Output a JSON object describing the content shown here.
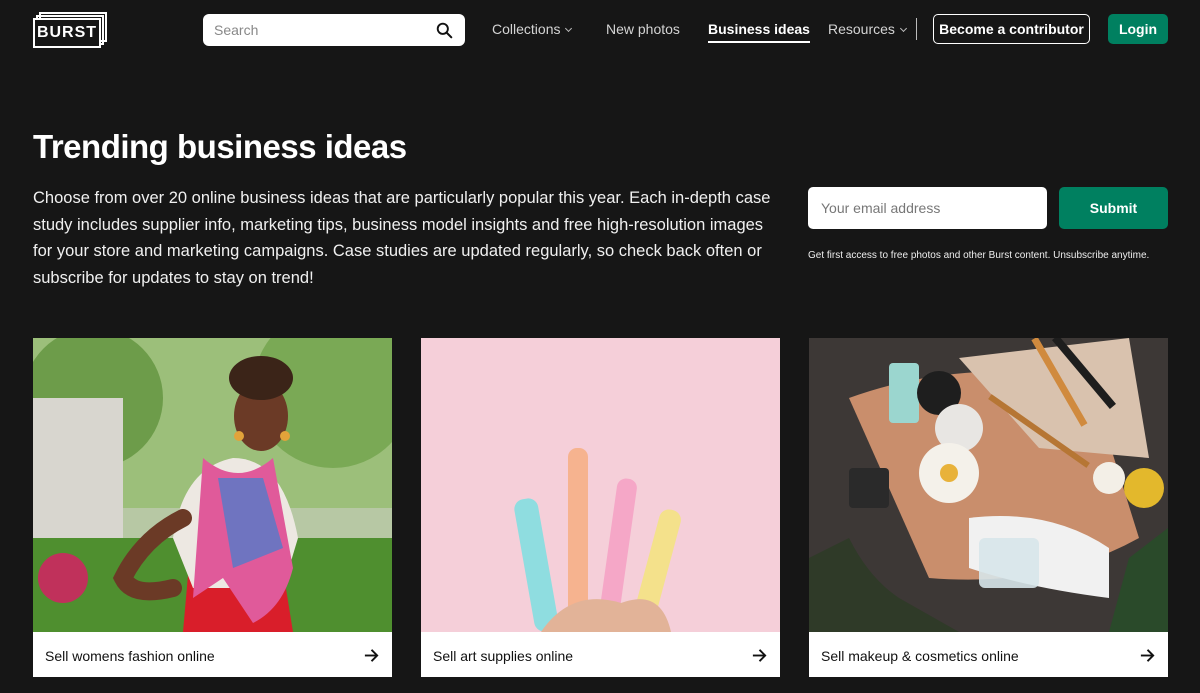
{
  "brand": {
    "logo_text": "BURST"
  },
  "search": {
    "placeholder": "Search",
    "icon": "search-icon"
  },
  "nav": {
    "collections": "Collections",
    "new_photos": "New photos",
    "business_ideas": "Business ideas",
    "resources": "Resources",
    "contributor_button": "Become a contributor",
    "login_button": "Login"
  },
  "hero": {
    "title": "Trending business ideas",
    "description": "Choose from over 20 online business ideas that are particularly popular this year. Each in-depth case study includes supplier info, marketing tips, business model insights and free high-resolution images for your store and marketing campaigns. Case studies are updated regularly, so check back often or subscribe for updates to stay on trend!"
  },
  "subscribe": {
    "email_placeholder": "Your email address",
    "submit_label": "Submit",
    "fineprint": "Get first access to free photos and other Burst content. Unsubscribe anytime."
  },
  "cards": [
    {
      "label": "Sell womens fashion online",
      "icon": "arrow-right-icon"
    },
    {
      "label": "Sell art supplies online",
      "icon": "arrow-right-icon"
    },
    {
      "label": "Sell makeup & cosmetics online",
      "icon": "arrow-right-icon"
    }
  ],
  "colors": {
    "background": "#161616",
    "accent": "#008060",
    "text": "#ffffff"
  }
}
